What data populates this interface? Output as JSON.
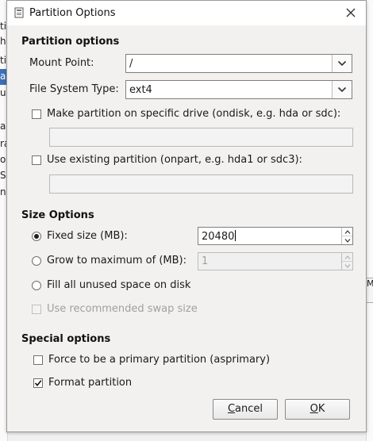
{
  "background": {
    "left_chars": [
      "ti",
      "h",
      "ti",
      "a",
      "u",
      "a",
      "ra",
      "o",
      "S",
      "n"
    ],
    "right_char": "M"
  },
  "dialog": {
    "title": "Partition Options",
    "close_glyph": "✕"
  },
  "partition_options": {
    "heading": "Partition options",
    "mount_point_label": "Mount Point:",
    "mount_point_value": "/",
    "fs_type_label": "File System Type:",
    "fs_type_value": "ext4",
    "ondisk_label": "Make partition on specific drive (ondisk, e.g. hda or sdc):",
    "ondisk_checked": false,
    "ondisk_value": "",
    "onpart_label": "Use existing partition (onpart, e.g. hda1 or sdc3):",
    "onpart_checked": false,
    "onpart_value": ""
  },
  "size_options": {
    "heading": "Size Options",
    "fixed_label": "Fixed size (MB):",
    "fixed_value": "20480",
    "grow_label": "Grow to maximum of (MB):",
    "grow_value": "1",
    "fill_label": "Fill all unused space on disk",
    "swap_label": "Use recommended swap size",
    "selected": "fixed"
  },
  "special_options": {
    "heading": "Special options",
    "primary_label": "Force to be a primary partition (asprimary)",
    "primary_checked": false,
    "format_label": "Format partition",
    "format_checked": true
  },
  "buttons": {
    "cancel_mnemonic": "C",
    "cancel_rest": "ancel",
    "ok_mnemonic": "O",
    "ok_rest": "K"
  },
  "colors": {
    "selection": "#3d6fb4",
    "window_bg": "#f2f1f0"
  }
}
